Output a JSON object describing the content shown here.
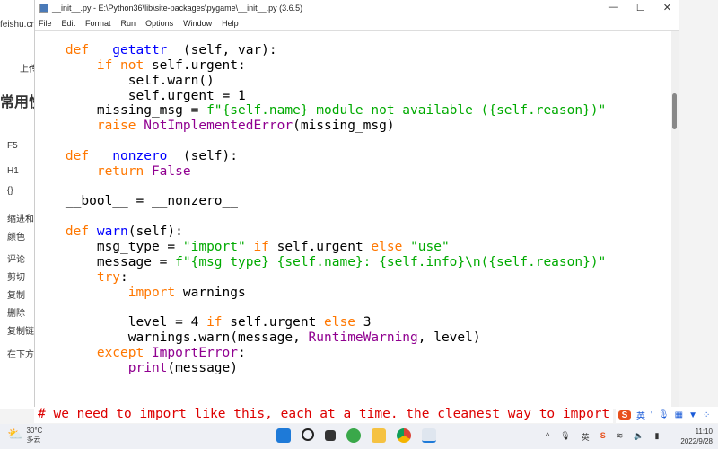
{
  "background": {
    "url": "feishu.cn",
    "items": [
      "上传",
      "常用快",
      "F5",
      "H1",
      "{}",
      "缩进和",
      "颜色",
      "评论",
      "剪切",
      "复制",
      "删除",
      "复制链",
      "在下方"
    ]
  },
  "window": {
    "title": "__init__.py - E:\\Python36\\lib\\site-packages\\pygame\\__init__.py (3.6.5)",
    "controls": [
      "—",
      "☐",
      "✕"
    ],
    "menu": [
      "File",
      "Edit",
      "Format",
      "Run",
      "Options",
      "Window",
      "Help"
    ]
  },
  "code": [
    [
      [
        "    ",
        ""
      ],
      [
        "def ",
        "kw"
      ],
      [
        "__getattr__",
        "df"
      ],
      [
        "(self, var):",
        ""
      ]
    ],
    [
      [
        "        ",
        ""
      ],
      [
        "if not ",
        "kw"
      ],
      [
        "self.urgent:",
        ""
      ]
    ],
    [
      [
        "            self.warn()",
        ""
      ]
    ],
    [
      [
        "            self.urgent = 1",
        ""
      ]
    ],
    [
      [
        "        missing_msg = ",
        ""
      ],
      [
        "f\"{self.name} module not available ({self.reason})\"",
        "st"
      ]
    ],
    [
      [
        "        ",
        ""
      ],
      [
        "raise ",
        "kw"
      ],
      [
        "NotImplementedError",
        "bi"
      ],
      [
        "(missing_msg)",
        ""
      ]
    ],
    [],
    [
      [
        "    ",
        ""
      ],
      [
        "def ",
        "kw"
      ],
      [
        "__nonzero__",
        "df"
      ],
      [
        "(self):",
        ""
      ]
    ],
    [
      [
        "        ",
        ""
      ],
      [
        "return ",
        "kw"
      ],
      [
        "False",
        "bi"
      ]
    ],
    [],
    [
      [
        "    __bool__ = __nonzero__",
        ""
      ]
    ],
    [],
    [
      [
        "    ",
        ""
      ],
      [
        "def ",
        "kw"
      ],
      [
        "warn",
        "df"
      ],
      [
        "(self):",
        ""
      ]
    ],
    [
      [
        "        msg_type = ",
        ""
      ],
      [
        "\"import\"",
        "st"
      ],
      [
        " if ",
        "kw"
      ],
      [
        "self.urgent ",
        ""
      ],
      [
        "else ",
        "kw"
      ],
      [
        "\"use\"",
        "st"
      ]
    ],
    [
      [
        "        message = ",
        ""
      ],
      [
        "f\"{msg_type} {self.name}: {self.info}\\n({self.reason})\"",
        "st"
      ]
    ],
    [
      [
        "        ",
        ""
      ],
      [
        "try",
        "kw"
      ],
      [
        ":",
        ""
      ]
    ],
    [
      [
        "            ",
        ""
      ],
      [
        "import ",
        "kw"
      ],
      [
        "warnings",
        ""
      ]
    ],
    [],
    [
      [
        "            level = 4 ",
        ""
      ],
      [
        "if ",
        "kw"
      ],
      [
        "self.urgent ",
        ""
      ],
      [
        "else ",
        "kw"
      ],
      [
        "3",
        ""
      ]
    ],
    [
      [
        "            warnings.warn(message, ",
        ""
      ],
      [
        "RuntimeWarning",
        "bi"
      ],
      [
        ", level)",
        ""
      ]
    ],
    [
      [
        "        ",
        ""
      ],
      [
        "except ",
        "kw"
      ],
      [
        "ImportError",
        "bi"
      ],
      [
        ":",
        ""
      ]
    ],
    [
      [
        "            ",
        ""
      ],
      [
        "print",
        "bi"
      ],
      [
        "(message)",
        ""
      ]
    ]
  ],
  "comment_line": "# we need to import like this, each at a time. the cleanest way to import",
  "ime": {
    "logo": "S",
    "lang": "英",
    "icons": [
      "punct-icon",
      "mic-icon",
      "keyboard-icon",
      "skin-icon",
      "menu-icon"
    ]
  },
  "taskbar": {
    "temp": "30°C",
    "weather": "多云",
    "time": "11:10",
    "date": "2022/9/28"
  }
}
